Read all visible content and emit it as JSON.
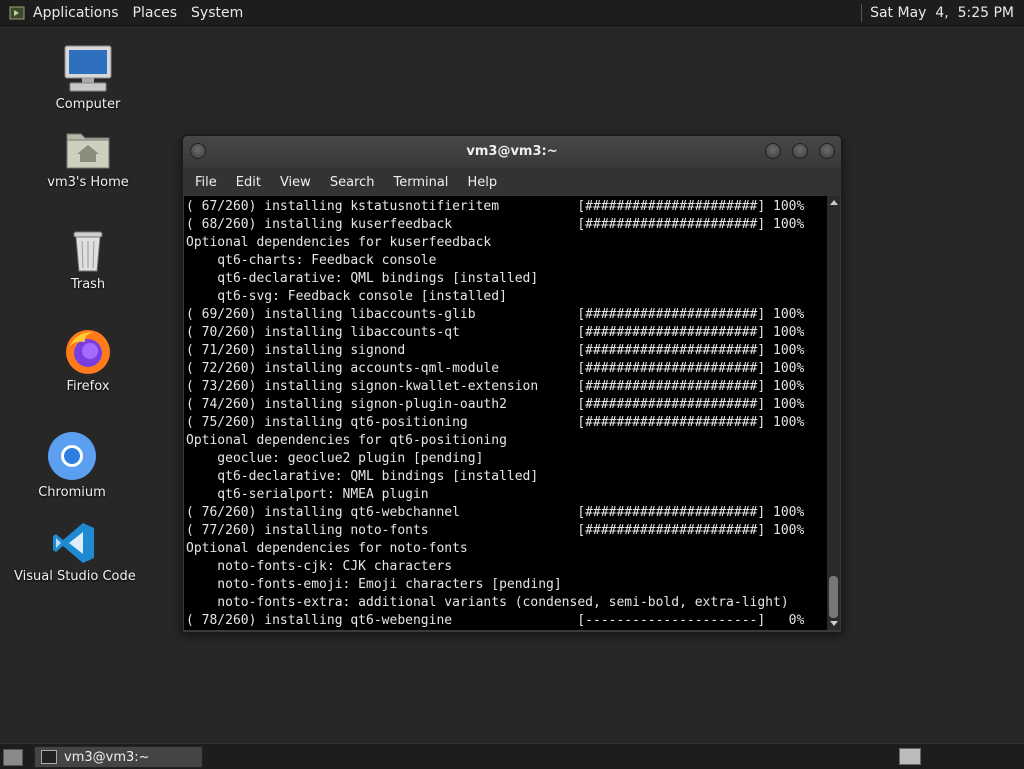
{
  "top_panel": {
    "menus": [
      "Applications",
      "Places",
      "System"
    ],
    "clock": "Sat May  4,  5:25 PM"
  },
  "desktop": {
    "icons": [
      {
        "label": "Computer",
        "icon": "computer-icon"
      },
      {
        "label": "vm3's Home",
        "icon": "home-folder-icon"
      },
      {
        "label": "Trash",
        "icon": "trash-icon"
      },
      {
        "label": "Firefox",
        "icon": "firefox-icon"
      },
      {
        "label": "Chromium",
        "icon": "chromium-icon"
      },
      {
        "label": "Visual Studio Code",
        "icon": "vscode-icon"
      }
    ]
  },
  "terminal": {
    "title": "vm3@vm3:~",
    "menu": [
      "File",
      "Edit",
      "View",
      "Search",
      "Terminal",
      "Help"
    ],
    "lines": [
      "( 67/260) installing kstatusnotifieritem          [######################] 100%",
      "( 68/260) installing kuserfeedback                [######################] 100%",
      "Optional dependencies for kuserfeedback",
      "    qt6-charts: Feedback console",
      "    qt6-declarative: QML bindings [installed]",
      "    qt6-svg: Feedback console [installed]",
      "( 69/260) installing libaccounts-glib             [######################] 100%",
      "( 70/260) installing libaccounts-qt               [######################] 100%",
      "( 71/260) installing signond                      [######################] 100%",
      "( 72/260) installing accounts-qml-module          [######################] 100%",
      "( 73/260) installing signon-kwallet-extension     [######################] 100%",
      "( 74/260) installing signon-plugin-oauth2         [######################] 100%",
      "( 75/260) installing qt6-positioning              [######################] 100%",
      "Optional dependencies for qt6-positioning",
      "    geoclue: geoclue2 plugin [pending]",
      "    qt6-declarative: QML bindings [installed]",
      "    qt6-serialport: NMEA plugin",
      "( 76/260) installing qt6-webchannel               [######################] 100%",
      "( 77/260) installing noto-fonts                   [######################] 100%",
      "Optional dependencies for noto-fonts",
      "    noto-fonts-cjk: CJK characters",
      "    noto-fonts-emoji: Emoji characters [pending]",
      "    noto-fonts-extra: additional variants (condensed, semi-bold, extra-light)",
      "( 78/260) installing qt6-webengine                [----------------------]   0%"
    ]
  },
  "taskbar": {
    "window_button": "vm3@vm3:~"
  }
}
